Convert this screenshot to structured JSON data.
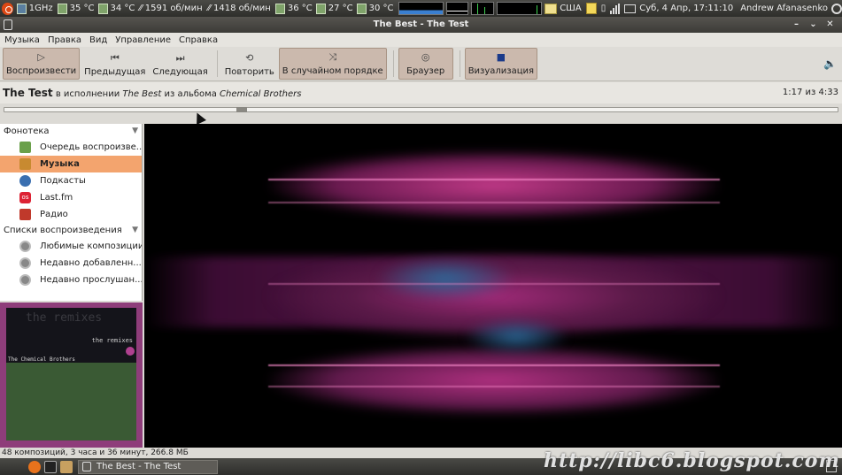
{
  "top_panel": {
    "cpu_freq": "1GHz",
    "temps": [
      "35 °C",
      "34 °C"
    ],
    "fan1": "1591 об/мин",
    "fan2": "1418 об/мин",
    "temps2": [
      "36 °C",
      "27 °C",
      "30 °C"
    ],
    "keyboard_layout": "США",
    "clock": "Суб, 4 Апр, 17:11:10",
    "user": "Andrew Afanasenko"
  },
  "window": {
    "title": "The Best - The Test",
    "controls": {
      "minimize": "–",
      "maximize": "⌄",
      "close": "✕"
    }
  },
  "menubar": [
    "Музыка",
    "Правка",
    "Вид",
    "Управление",
    "Справка"
  ],
  "toolbar": {
    "play": "Воспроизвести",
    "prev": "Предыдущая",
    "next": "Следующая",
    "repeat": "Повторить",
    "shuffle": "В случайном порядке",
    "browser": "Браузер",
    "visualization": "Визуализация",
    "icons": {
      "play": "▷",
      "prev": "⏮",
      "next": "⏭",
      "repeat": "⟲",
      "shuffle": "⤨",
      "browser": "◎",
      "visualization": "■",
      "volume": "🔈"
    }
  },
  "now_playing": {
    "title": "The Test",
    "by": "в исполнении",
    "artist": "The Best",
    "from": "из альбома",
    "album": "Chemical Brothers",
    "time": "1:17 из 4:33",
    "progress": 0.282
  },
  "sidebar": {
    "library_header": "Фонотека",
    "library": [
      {
        "label": "Очередь воспроизве...",
        "icon": "queue-icon"
      },
      {
        "label": "Музыка",
        "icon": "music-icon",
        "selected": true
      },
      {
        "label": "Подкасты",
        "icon": "podcast-icon"
      },
      {
        "label": "Last.fm",
        "icon": "lastfm-icon"
      },
      {
        "label": "Радио",
        "icon": "radio-icon"
      }
    ],
    "playlists_header": "Списки воспроизведения",
    "playlists": [
      {
        "label": "Любимые композиции"
      },
      {
        "label": "Недавно добавленн..."
      },
      {
        "label": "Недавно прослушан..."
      }
    ]
  },
  "cover": {
    "title": "the remixes",
    "subtitle": "the remixes",
    "band": "The Chemical Brothers"
  },
  "status": "48 композиций, 3 часа и 36 минут, 266.8 МБ",
  "taskbar": {
    "task": "The Best - The Test"
  },
  "watermark": "http://libc6.blogspot.com"
}
